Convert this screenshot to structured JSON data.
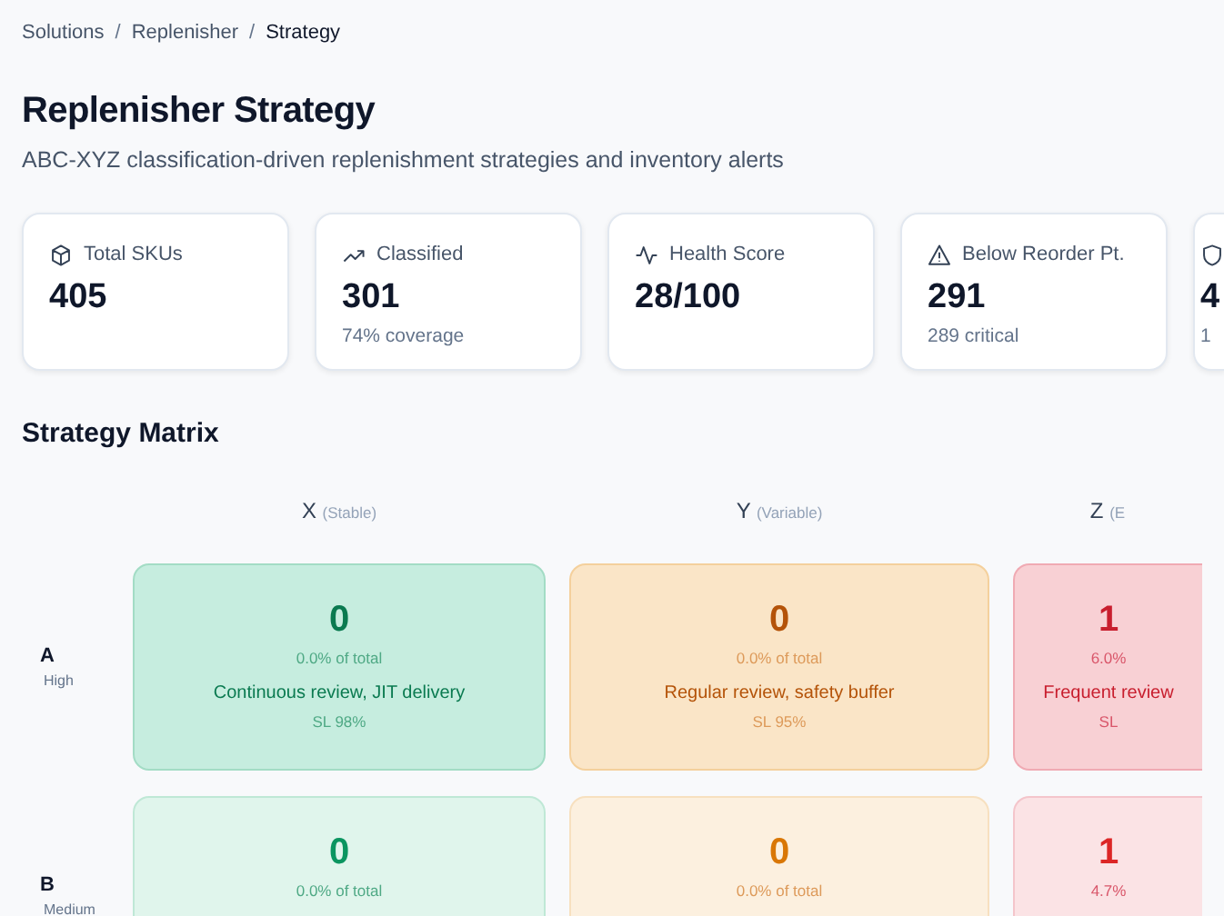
{
  "breadcrumb": [
    {
      "label": "Solutions",
      "current": false
    },
    {
      "separator": "/",
      "label": "Replenisher",
      "current": false
    },
    {
      "separator": "/",
      "label": "Strategy",
      "current": true
    }
  ],
  "title": "Replenisher Strategy",
  "subtitle": "ABC-XYZ classification-driven replenishment strategies and inventory alerts",
  "stats": [
    {
      "kind": "box",
      "label": "Total SKUs",
      "value": "405"
    },
    {
      "kind": "trend",
      "label": "Classified",
      "value": "301",
      "note": "74% coverage"
    },
    {
      "kind": "pulse",
      "label": "Health Score",
      "value": "28/100"
    },
    {
      "kind": "warning",
      "label": "Below Reorder Pt.",
      "value": "291",
      "note": "289 critical"
    },
    {
      "kind": "shield",
      "value": "4",
      "note": "1"
    }
  ],
  "matrix": {
    "title": "Strategy Matrix",
    "columns": [
      {
        "letter": "X",
        "label": "(Stable)"
      },
      {
        "letter": "Y",
        "label": "(Variable)"
      },
      {
        "letter": "Z",
        "label": "(E"
      }
    ],
    "rows": [
      {
        "letter": "A",
        "label": "High",
        "kind": "strong",
        "cells": [
          {
            "kind": "green",
            "count": "0",
            "share": "0.0% of total",
            "strategy": "Continuous review, JIT delivery",
            "service": "SL 98%"
          },
          {
            "kind": "orange",
            "count": "0",
            "share": "0.0% of total",
            "strategy": "Regular review, safety buffer",
            "service": "SL 95%"
          },
          {
            "kind": "red",
            "count": "1",
            "share": "6.0%",
            "strategy": "Frequent review",
            "service": "SL"
          }
        ]
      },
      {
        "letter": "B",
        "label": "Medium",
        "kind": "light",
        "cells": [
          {
            "kind": "green",
            "count": "0",
            "share": "0.0% of total"
          },
          {
            "kind": "orange",
            "count": "0",
            "share": "0.0% of total"
          },
          {
            "kind": "red",
            "count": "1",
            "share": "4.7%"
          }
        ]
      }
    ]
  }
}
